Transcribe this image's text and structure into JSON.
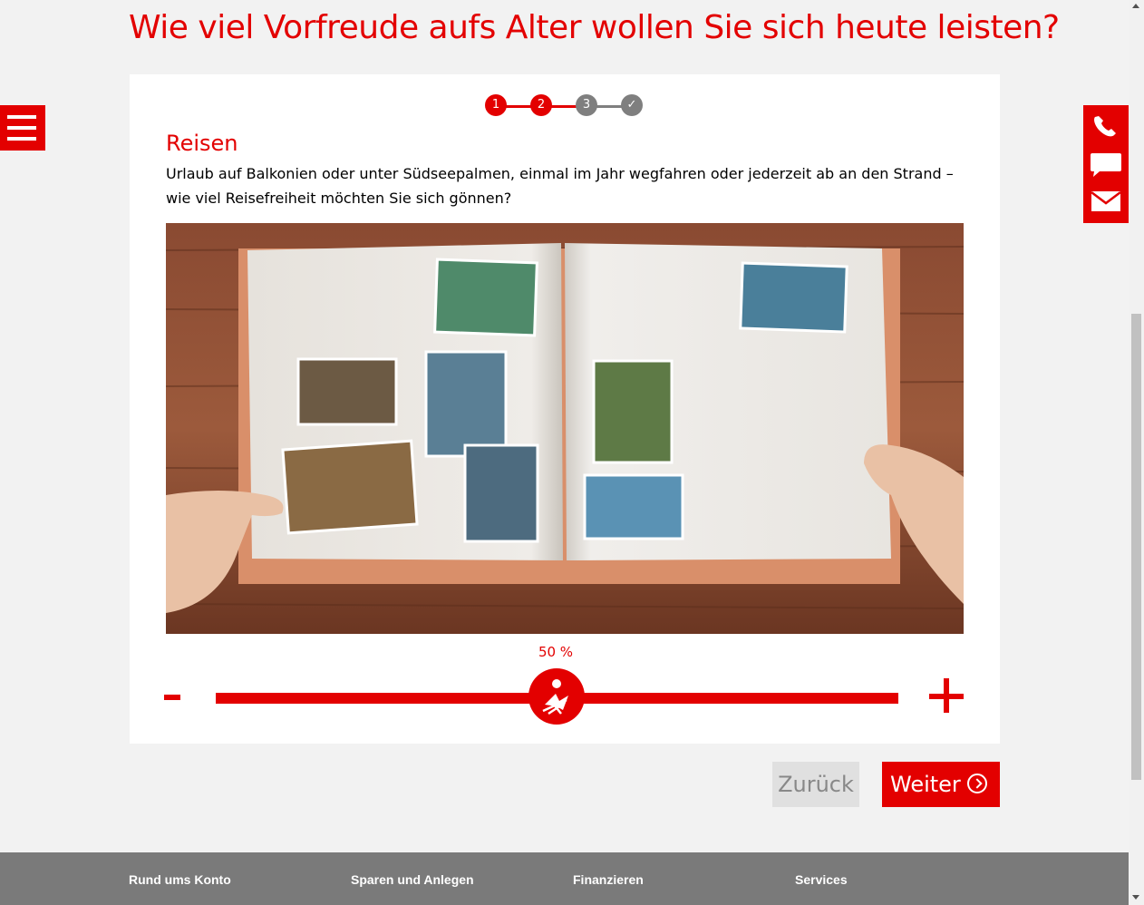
{
  "page": {
    "title": "Wie viel Vorfreude aufs Alter wollen Sie sich heute leisten?"
  },
  "stepper": {
    "steps": [
      {
        "label": "1",
        "state": "done"
      },
      {
        "label": "2",
        "state": "active"
      },
      {
        "label": "3",
        "state": "pending"
      },
      {
        "label": "✓",
        "state": "pending"
      }
    ]
  },
  "section": {
    "title": "Reisen",
    "description": "Urlaub auf Balkonien oder unter Südseepalmen, einmal im Jahr wegfahren oder jederzeit ab an den Strand – wie viel Reisefreiheit möchten Sie sich gönnen?"
  },
  "slider": {
    "value_label": "50 %",
    "value": 50,
    "min": 0,
    "max": 100,
    "minus_label": "-",
    "plus_label": "+",
    "thumb_icon": "deckchair-icon"
  },
  "buttons": {
    "back_label": "Zurück",
    "next_label": "Weiter"
  },
  "side_nav": {
    "menu_icon": "hamburger-icon",
    "contact_icons": [
      "phone-icon",
      "chat-icon",
      "mail-icon"
    ]
  },
  "footer": {
    "columns": [
      {
        "heading": "Rund ums Konto"
      },
      {
        "heading": "Sparen und Anlegen"
      },
      {
        "heading": "Finanzieren"
      },
      {
        "heading": "Services"
      }
    ]
  },
  "colors": {
    "brand": "#e30000",
    "step_pending": "#7f7f7f",
    "footer": "#7a7a7a"
  }
}
